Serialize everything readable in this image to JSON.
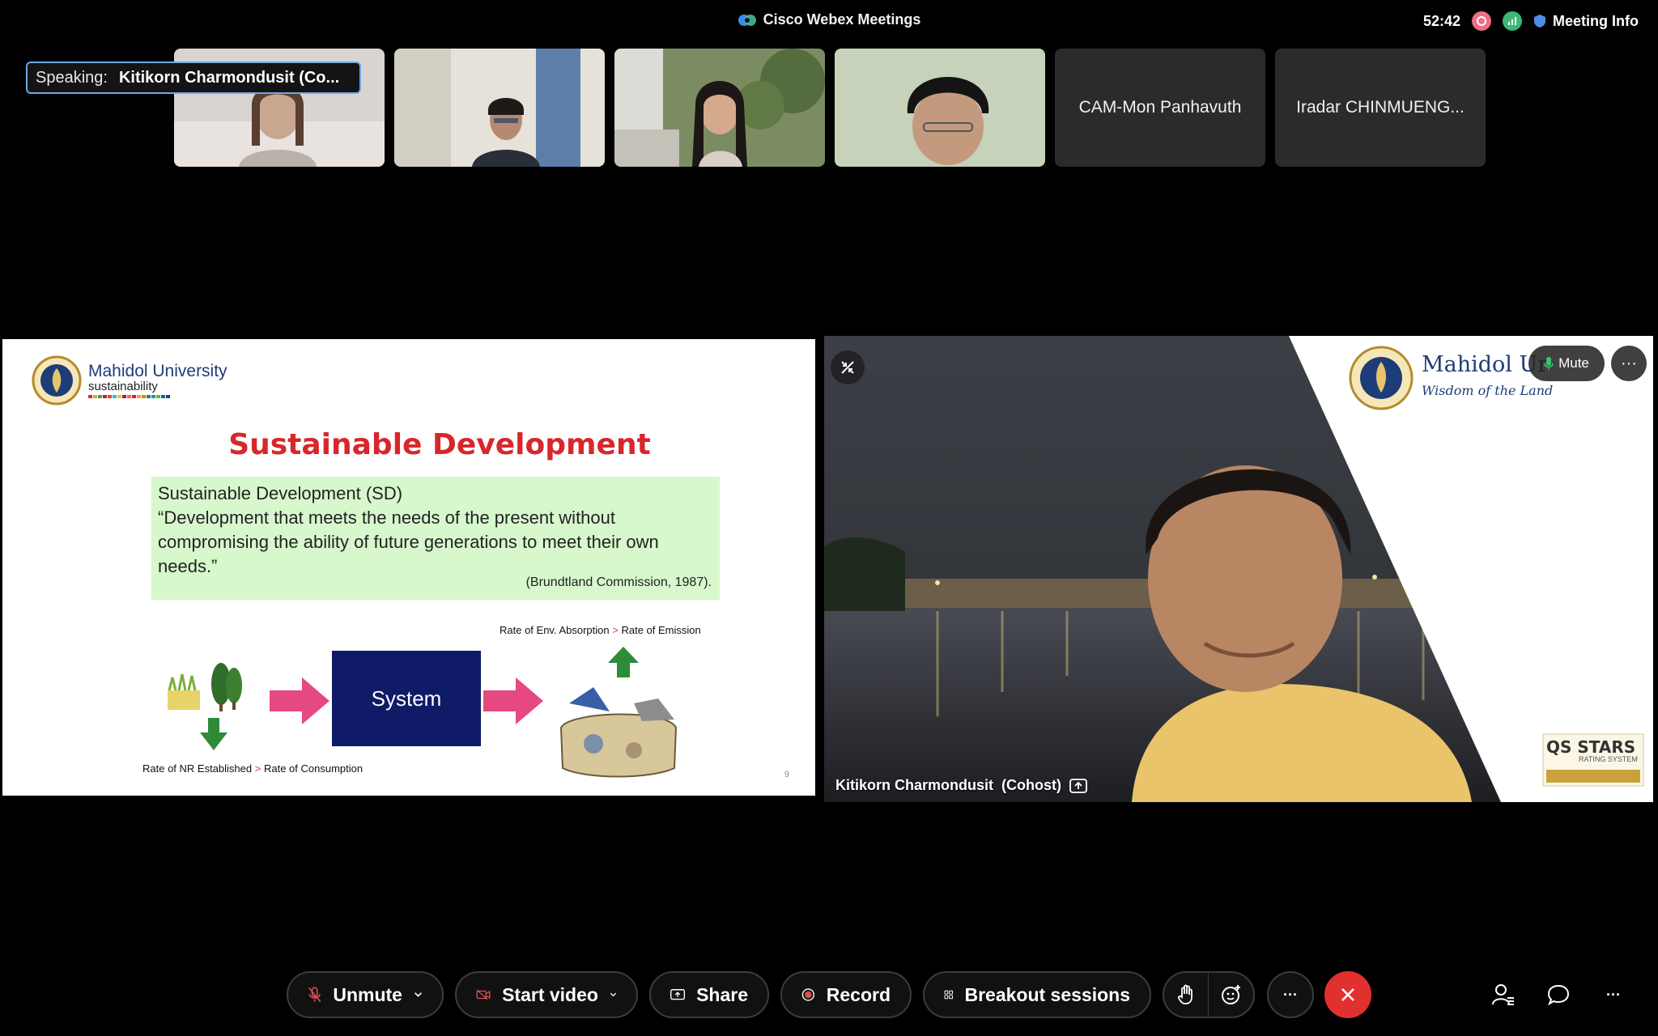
{
  "window": {
    "title": "Cisco Webex Meetings"
  },
  "status": {
    "timer": "52:42",
    "meeting_info_label": "Meeting Info"
  },
  "speaking": {
    "label": "Speaking:",
    "name": "Kitikorn Charmondusit (Co..."
  },
  "participants": [
    {
      "name": "CAM-Mon Panhavuth"
    },
    {
      "name": "Iradar CHINMUENG..."
    }
  ],
  "slide": {
    "logo_name": "Mahidol University",
    "logo_sub": "sustainability",
    "title": "Sustainable Development",
    "definition": {
      "heading": "Sustainable Development (SD)",
      "quote": "“Development that meets the needs of the present without compromising the ability of future generations to meet their own needs.”",
      "citation": "(Brundtland Commission, 1987)."
    },
    "top_rate": {
      "left": "Rate of Env. Absorption",
      "sep": ">",
      "right": "Rate of Emission"
    },
    "bottom_rate": {
      "left": "Rate of NR Established",
      "sep": ">",
      "right": "Rate of Consumption"
    },
    "system_label": "System",
    "page_number": "9"
  },
  "camera": {
    "mute_label": "Mute",
    "participant_name": "Kitikorn Charmondusit",
    "role": "(Cohost)",
    "backdrop_logo": "Mahidol Ur",
    "backdrop_motto": "Wisdom of the Land",
    "badge_line1": "QS STARS",
    "badge_line2": "RATING SYSTEM"
  },
  "controls": {
    "unmute": "Unmute",
    "start_video": "Start video",
    "share": "Share",
    "record": "Record",
    "breakout": "Breakout sessions",
    "more": "···"
  },
  "colors": {
    "end_call": "#e0312f",
    "accent": "#6ea8e8",
    "slide_title": "#d7272c",
    "system_box": "#0f1b66"
  }
}
